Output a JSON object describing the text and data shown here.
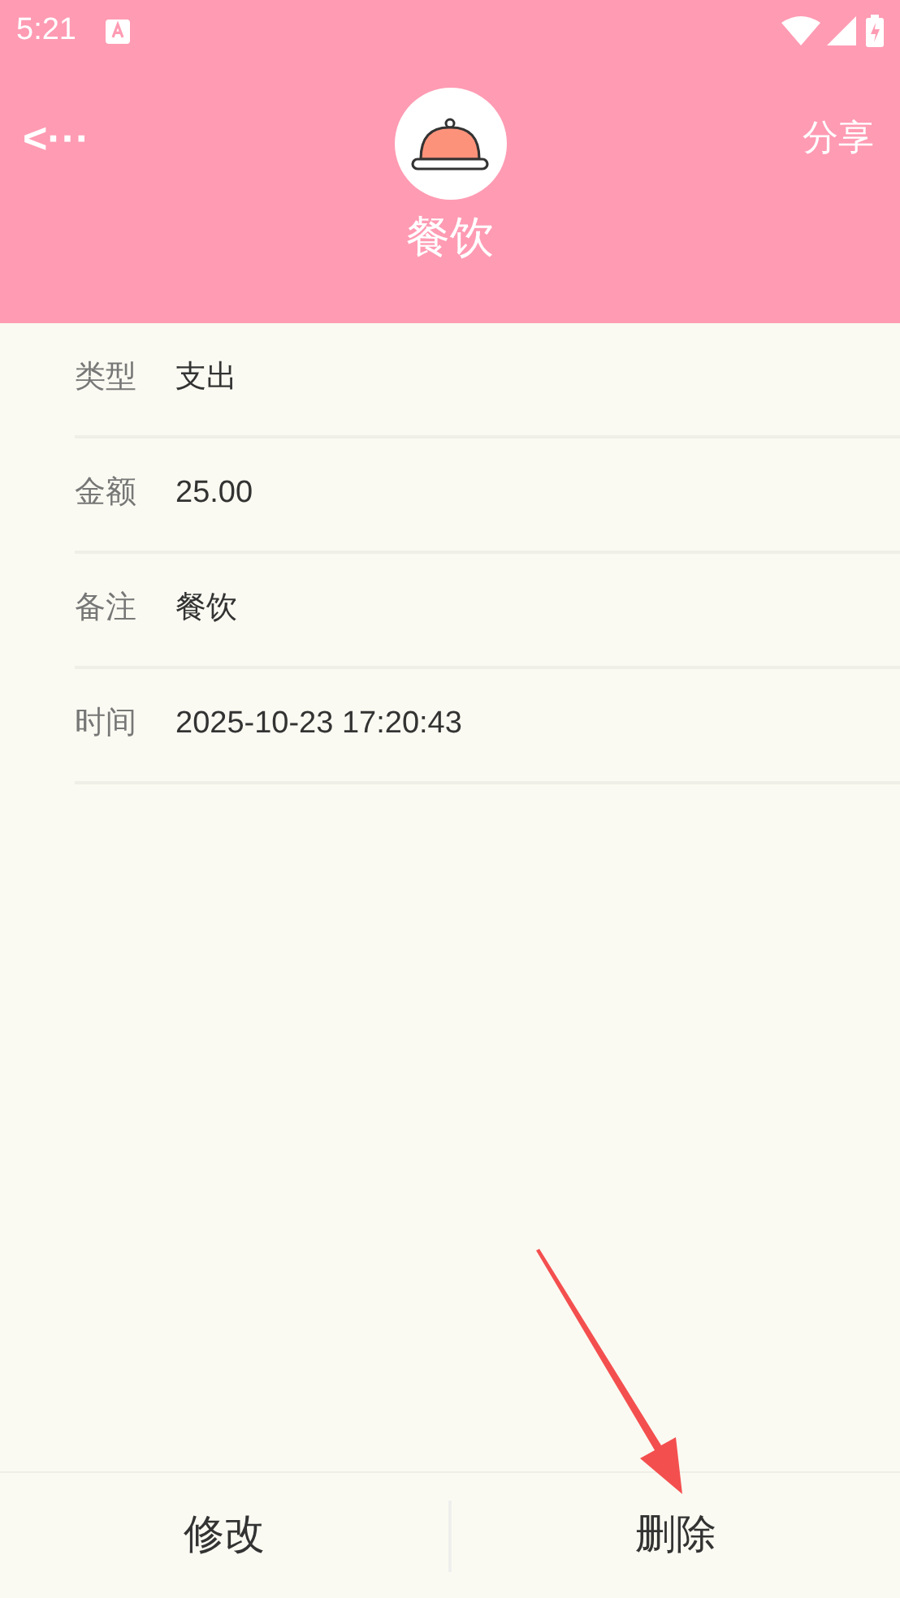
{
  "status_bar": {
    "time": "5:21"
  },
  "header": {
    "back": "<···",
    "title": "餐饮",
    "action": "分享"
  },
  "details": [
    {
      "label": "类型",
      "value": "支出"
    },
    {
      "label": "金额",
      "value": "25.00"
    },
    {
      "label": "备注",
      "value": "餐饮"
    },
    {
      "label": "时间",
      "value": "2025-10-23 17:20:43"
    }
  ],
  "actions": [
    "修改",
    "删除"
  ]
}
